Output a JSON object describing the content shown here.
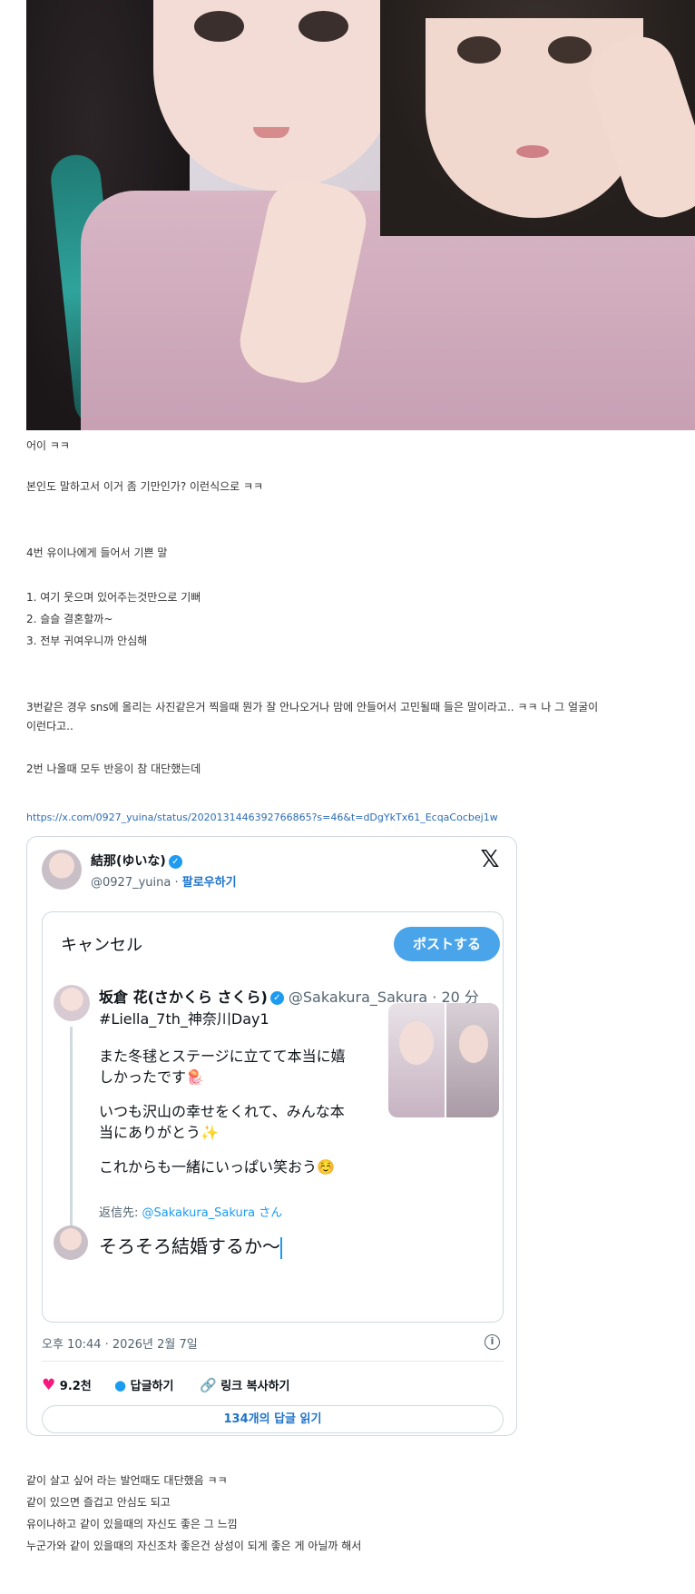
{
  "post": {
    "lines_top": [
      "어이 ㅋㅋ",
      "본인도 말하고서 이거 좀 기만인가? 이런식으로 ㅋㅋ",
      "4번 유이나에게 들어서 기쁜 말",
      "1. 여기 웃으며 있어주는것만으로 기뻐",
      "2. 슬슬 결혼할까~",
      "3. 전부 귀여우니까 안심해",
      "3번같은 경우 sns에 올리는 사진같은거 찍을때 뭔가 잘 안나오거나 맘에 안들어서 고민될때 들은 말이라고.. ㅋㅋ 나 그 얼굴이",
      "이런다고..",
      "2번 나올때 모두 반응이 참 대단했는데"
    ],
    "link": "https://x.com/0927_yuina/status/2020131446392766865?s=46&t=dDgYkTx61_EcqaCocbej1w",
    "lines_bottom": [
      "같이 살고 싶어 라는 발언때도 대단했음 ㅋㅋ",
      "같이 있으면 즐겁고 안심도 되고",
      "유이나하고 같이 있을때의 자신도 좋은 그 느낌",
      "누군가와 같이 있을때의 자신조차 좋은건 상성이 되게 좋은 게 아닐까 해서"
    ]
  },
  "tweet": {
    "name": "結那(ゆいな)",
    "handle": "@0927_yuina",
    "follow": "팔로우하기",
    "x_logo": "𝕏",
    "cancel": "キャンセル",
    "post_button": "ポストする",
    "quoted": {
      "name": "坂倉 花(さかくら さくら)",
      "handle_time": "@Sakakura_Sakura · 20 分",
      "hashtag": "#Liella_7th_神奈川Day1",
      "para1": "また冬毬とステージに立てて本当に嬉しかったです🪼",
      "para2": "いつも沢山の幸せをくれて、みんな本当にありがとう✨",
      "para3": "これからも一緒にいっぱい笑おう☺️",
      "reply_prefix": "返信先: ",
      "reply_handle": "@Sakakura_Sakura",
      "reply_suffix": " さん"
    },
    "reply_text": "そろそろ結婚するか〜",
    "timestamp": "오후 10:44 · 2026년 2월 7일",
    "likes": "9.2천",
    "reply_label": "답글하기",
    "copy_link": "링크 복사하기",
    "read_replies": "134개의 답글 읽기"
  },
  "icons": {
    "verified": "verified-badge-icon",
    "heart": "heart-icon",
    "reply": "reply-bubble-icon",
    "link": "link-icon",
    "info": "info-icon"
  },
  "colors": {
    "accent_blue": "#1d9bf0",
    "post_button": "#4aa4ea",
    "heart": "#f91880",
    "link": "#2b6cb8"
  }
}
